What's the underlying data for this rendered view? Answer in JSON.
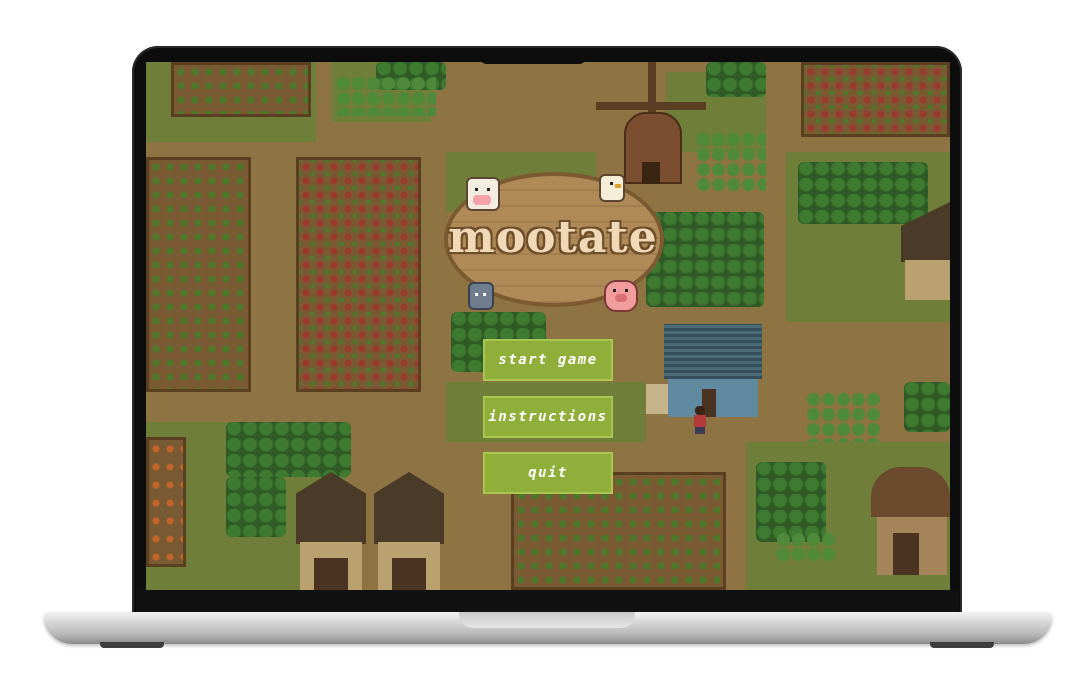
{
  "game": {
    "title": "mootate",
    "menu": {
      "start_label": "start game",
      "instructions_label": "instructions",
      "quit_label": "quit"
    }
  },
  "colors": {
    "button_bg": "#8faf3a",
    "button_text": "#ffffff",
    "grass": "#6f7f3a",
    "dirt": "#8d7442",
    "logo_text": "#f1d8b6"
  },
  "icons": [
    "cow-icon",
    "chicken-icon",
    "pig-icon",
    "cat-icon",
    "windmill-icon",
    "farmer-icon"
  ]
}
